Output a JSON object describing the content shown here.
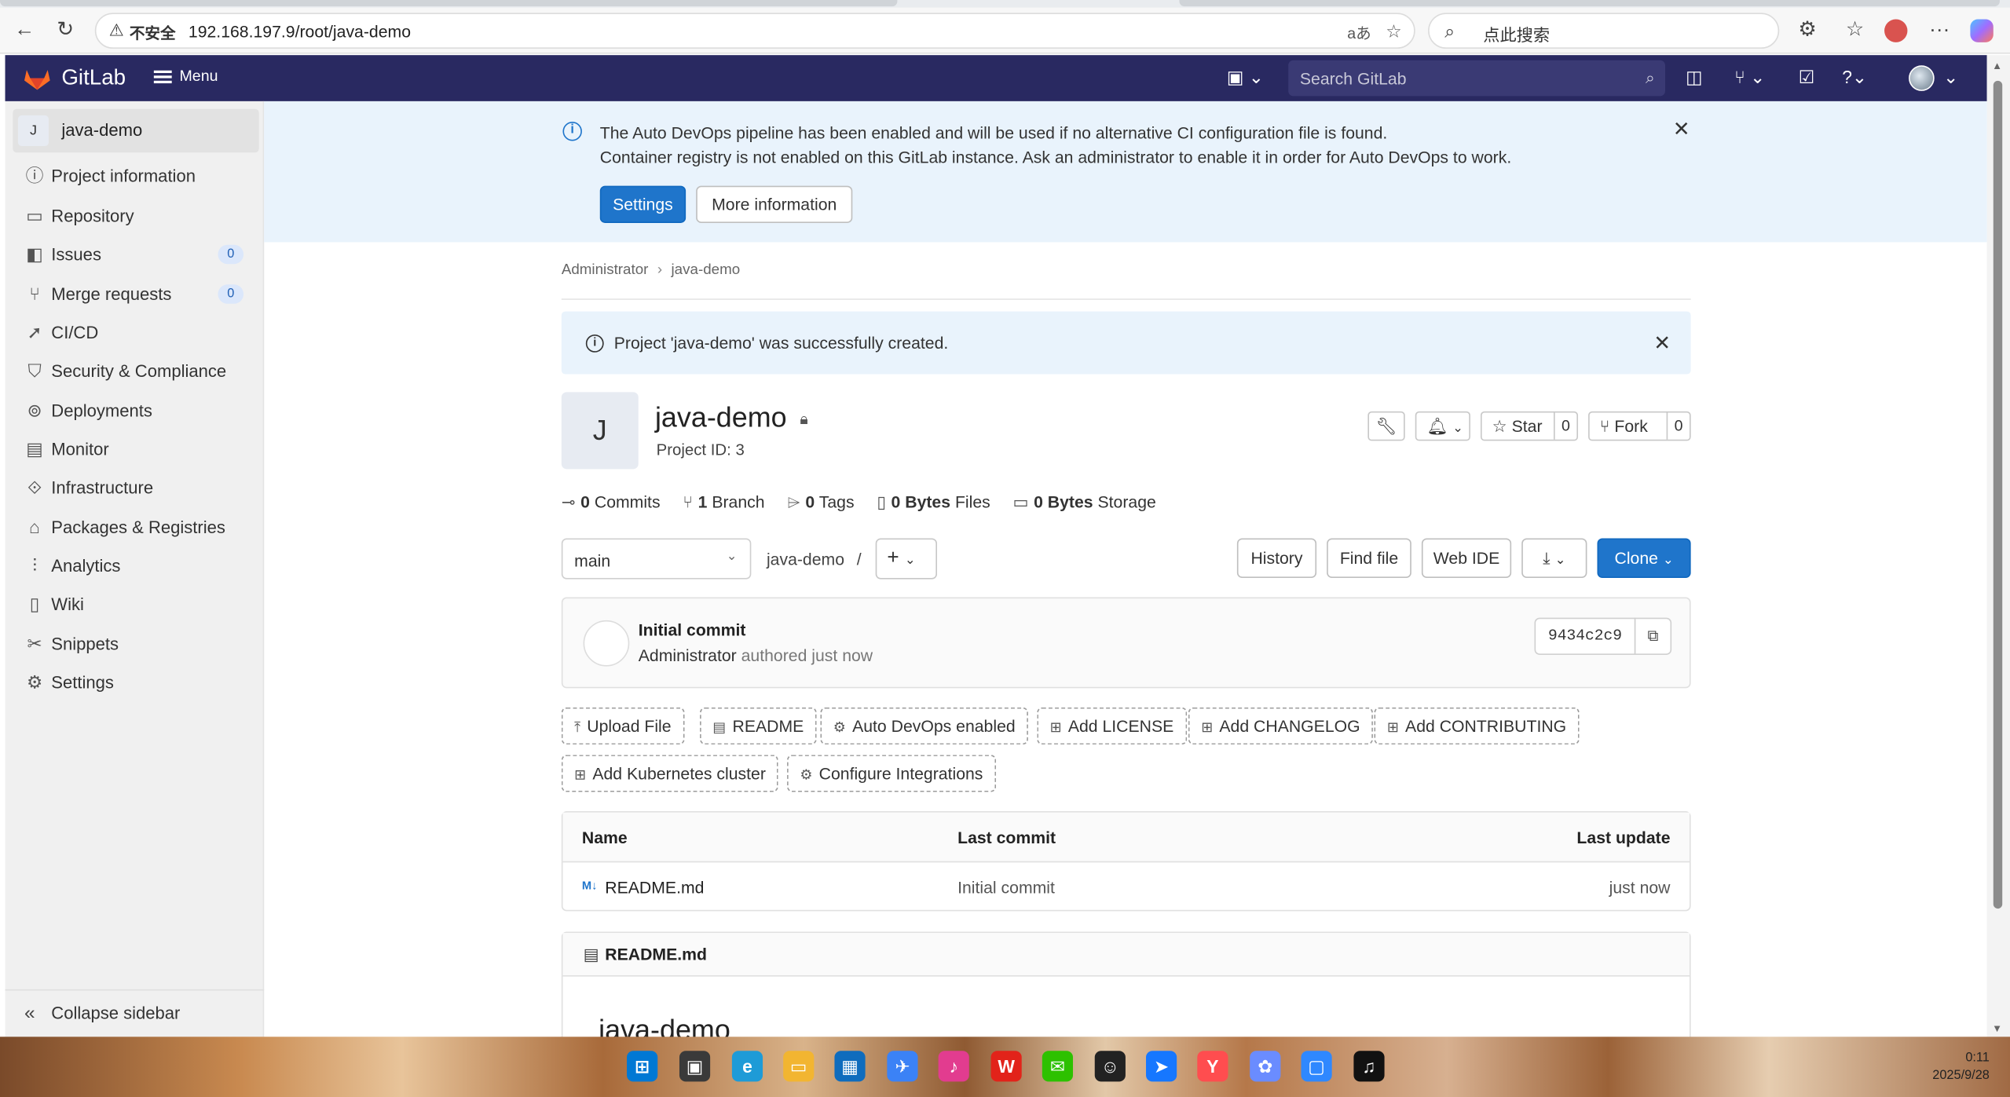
{
  "browser": {
    "insecure_label": "不安全",
    "url": "192.168.197.9/root/java-demo",
    "search_placeholder": "点此搜索"
  },
  "header": {
    "brand": "GitLab",
    "menu_label": "Menu",
    "search_placeholder": "Search GitLab"
  },
  "sidebar": {
    "context": {
      "avatar_letter": "J",
      "name": "java-demo"
    },
    "items": [
      {
        "label": "Project information",
        "icon": "project-info-icon"
      },
      {
        "label": "Repository",
        "icon": "repository-icon"
      },
      {
        "label": "Issues",
        "icon": "issues-icon",
        "badge": "0"
      },
      {
        "label": "Merge requests",
        "icon": "merge-request-icon",
        "badge": "0"
      },
      {
        "label": "CI/CD",
        "icon": "rocket-icon"
      },
      {
        "label": "Security & Compliance",
        "icon": "shield-icon"
      },
      {
        "label": "Deployments",
        "icon": "deployments-icon"
      },
      {
        "label": "Monitor",
        "icon": "monitor-icon"
      },
      {
        "label": "Infrastructure",
        "icon": "infrastructure-icon"
      },
      {
        "label": "Packages & Registries",
        "icon": "package-icon"
      },
      {
        "label": "Analytics",
        "icon": "analytics-icon"
      },
      {
        "label": "Wiki",
        "icon": "wiki-icon"
      },
      {
        "label": "Snippets",
        "icon": "snippets-icon"
      },
      {
        "label": "Settings",
        "icon": "gear-icon"
      }
    ],
    "collapse_label": "Collapse sidebar"
  },
  "devops_banner": {
    "line1": "The Auto DevOps pipeline has been enabled and will be used if no alternative CI configuration file is found.",
    "line2": "Container registry is not enabled on this GitLab instance. Ask an administrator to enable it in order for Auto DevOps to work.",
    "settings_button": "Settings",
    "more_info_button": "More information"
  },
  "breadcrumb": {
    "parent": "Administrator",
    "current": "java-demo"
  },
  "created_alert": {
    "text": "Project 'java-demo' was successfully created."
  },
  "project": {
    "avatar_letter": "J",
    "name": "java-demo",
    "id_label": "Project ID: 3",
    "star_label": "Star",
    "star_count": "0",
    "fork_label": "Fork",
    "fork_count": "0"
  },
  "stats": {
    "commits_count": "0",
    "commits_label": "Commits",
    "branches_count": "1",
    "branches_label": "Branch",
    "tags_count": "0",
    "tags_label": "Tags",
    "files_size": "0 Bytes",
    "files_label": "Files",
    "storage_size": "0 Bytes",
    "storage_label": "Storage"
  },
  "repo_toolbar": {
    "branch": "main",
    "path": "java-demo",
    "path_sep": "/",
    "history": "History",
    "find_file": "Find file",
    "web_ide": "Web IDE",
    "clone": "Clone"
  },
  "last_commit": {
    "title": "Initial commit",
    "author": "Administrator",
    "authored": "authored just now",
    "sha": "9434c2c9"
  },
  "quick_actions": [
    "Upload File",
    "README",
    "Auto DevOps enabled",
    "Add LICENSE",
    "Add CHANGELOG",
    "Add CONTRIBUTING",
    "Add Kubernetes cluster",
    "Configure Integrations"
  ],
  "file_table": {
    "headers": {
      "name": "Name",
      "last_commit": "Last commit",
      "last_update": "Last update"
    },
    "rows": [
      {
        "name": "README.md",
        "last_commit": "Initial commit",
        "last_update": "just now"
      }
    ]
  },
  "readme": {
    "filename": "README.md",
    "heading": "java-demo"
  },
  "taskbar": {
    "time": "0:11",
    "date": "2025/9/28"
  },
  "colors": {
    "header_bg": "#292961",
    "primary": "#1f75cb",
    "banner_bg": "#e9f3fc",
    "sidebar_bg": "#f0f0f0"
  }
}
